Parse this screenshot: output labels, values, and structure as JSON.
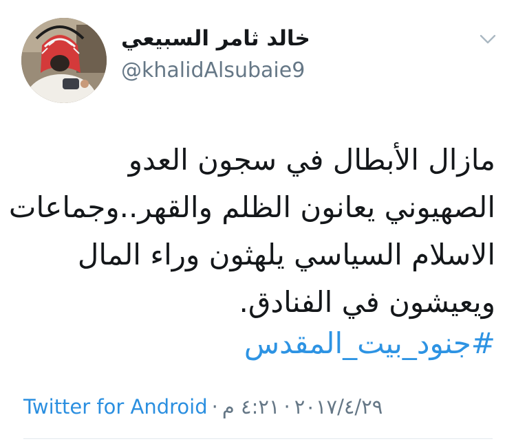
{
  "user": {
    "display_name": "خالد ثامر السبيعي",
    "handle": "@khalidAlsubaie9"
  },
  "tweet": {
    "lines": [
      "مازال الأبطال في سجون العدو",
      "الصهيوني يعانون الظلم والقهر..وجماعات",
      "الاسلام السياسي يلهثون وراء المال",
      "ويعيشون في الفنادق."
    ],
    "hashtag": "#جنود_بيت_المقدس",
    "time": "٤:٢١ م",
    "date": "٢٠١٧/٤/٢٩",
    "separator": "·",
    "source": "Twitter for Android"
  },
  "colors": {
    "link": "#2b8fe0",
    "secondary_text": "#657786",
    "divider": "#e1e8ed"
  },
  "icons": {
    "menu": "chevron-down-icon"
  }
}
